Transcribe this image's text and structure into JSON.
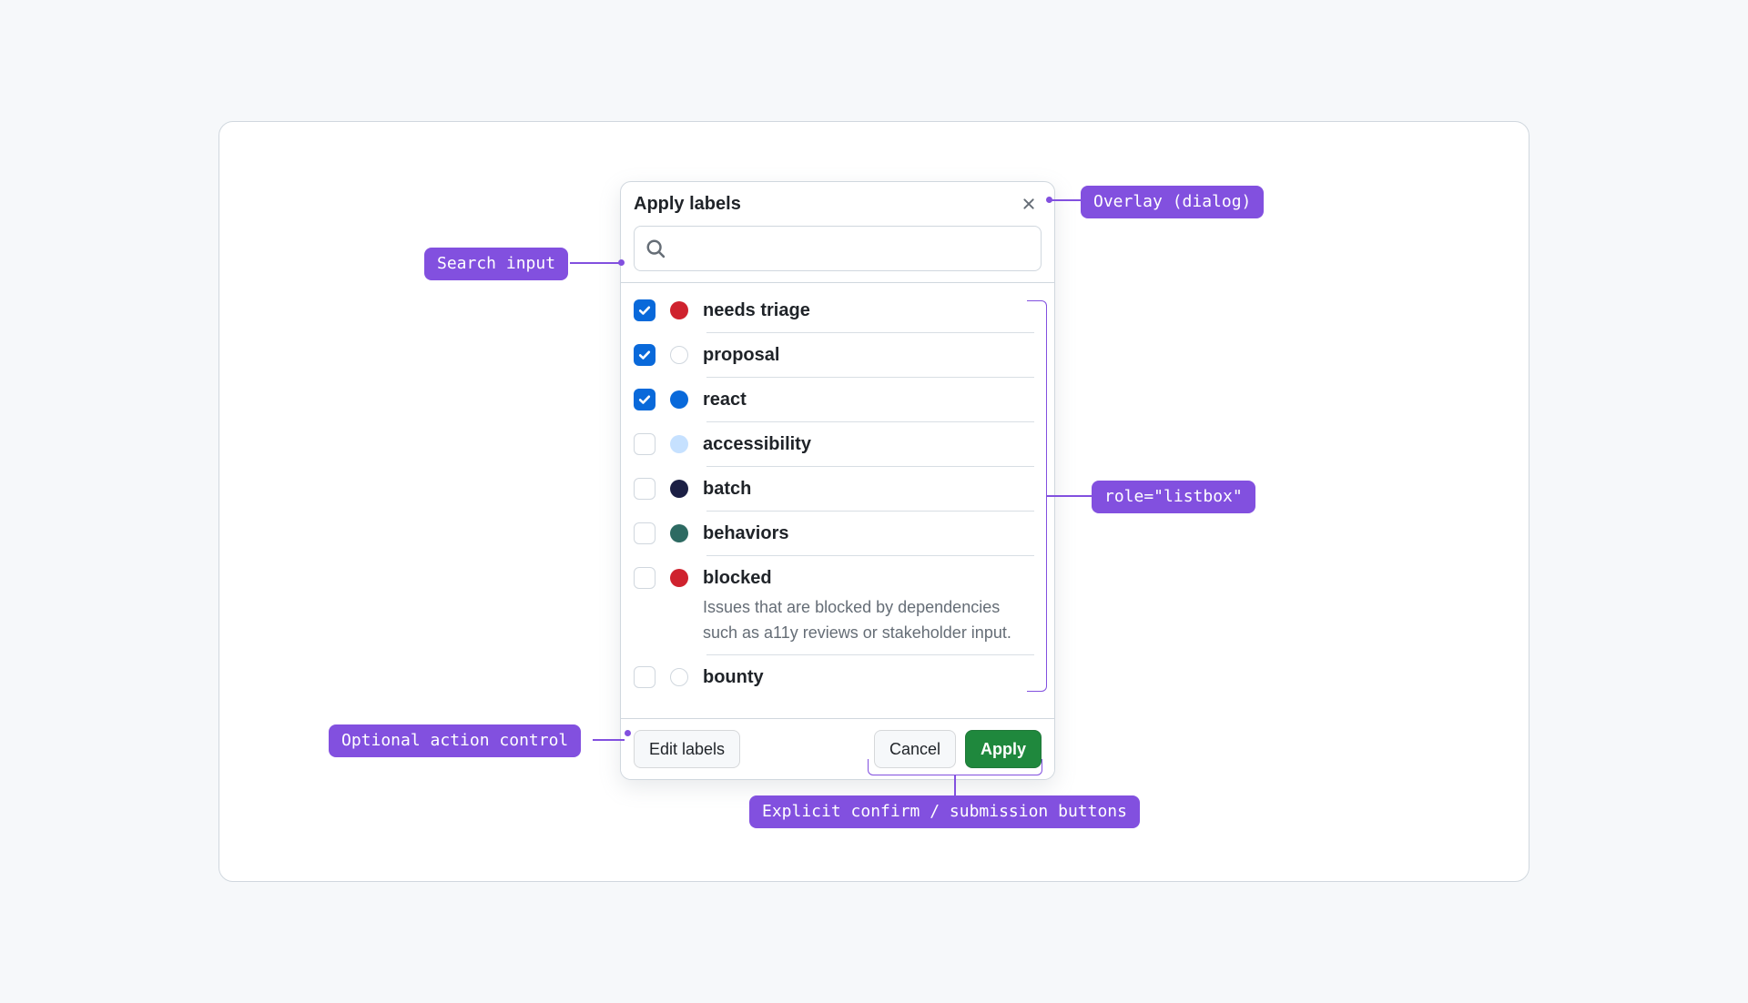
{
  "dialog": {
    "title": "Apply labels",
    "search_placeholder": "",
    "labels": [
      {
        "name": "needs triage",
        "color": "#cf222e",
        "outline": false,
        "checked": true,
        "desc": ""
      },
      {
        "name": "proposal",
        "color": "#ffffff",
        "outline": true,
        "checked": true,
        "desc": ""
      },
      {
        "name": "react",
        "color": "#0969da",
        "outline": false,
        "checked": true,
        "desc": ""
      },
      {
        "name": "accessibility",
        "color": "#c6e1ff",
        "outline": false,
        "checked": false,
        "desc": ""
      },
      {
        "name": "batch",
        "color": "#1b1f44",
        "outline": false,
        "checked": false,
        "desc": ""
      },
      {
        "name": "behaviors",
        "color": "#2d6a62",
        "outline": false,
        "checked": false,
        "desc": ""
      },
      {
        "name": "blocked",
        "color": "#cf222e",
        "outline": false,
        "checked": false,
        "desc": "Issues that are blocked by dependencies such as a11y reviews or stakeholder input."
      },
      {
        "name": "bounty",
        "color": "#e7e9ec",
        "outline": true,
        "checked": false,
        "desc": ""
      }
    ],
    "footer": {
      "edit": "Edit labels",
      "cancel": "Cancel",
      "apply": "Apply"
    }
  },
  "annotations": {
    "overlay": "Overlay (dialog)",
    "search": "Search input",
    "listbox": "role=\"listbox\"",
    "optional_action": "Optional action control",
    "confirm": "Explicit confirm / submission buttons"
  }
}
